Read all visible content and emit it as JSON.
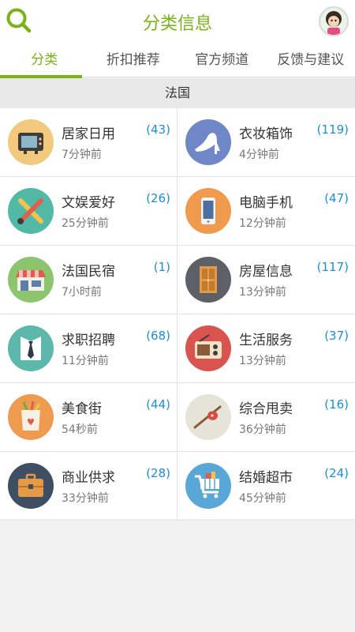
{
  "header": {
    "title": "分类信息",
    "accent_color": "#7ab317",
    "search_icon": "search-icon",
    "avatar_icon": "avatar"
  },
  "tabs": [
    {
      "label": "分类",
      "active": true
    },
    {
      "label": "折扣推荐",
      "active": false
    },
    {
      "label": "官方频道",
      "active": false
    },
    {
      "label": "反馈与建议",
      "active": false
    }
  ],
  "section": {
    "title": "法国"
  },
  "categories": [
    {
      "name": "居家日用",
      "count": "(43)",
      "time": "7分钟前",
      "icon": "tv-icon",
      "color": "#f2c97d"
    },
    {
      "name": "衣妆箱饰",
      "count": "(119)",
      "time": "4分钟前",
      "icon": "high-heel-icon",
      "color": "#6f87c6"
    },
    {
      "name": "文娱爱好",
      "count": "(26)",
      "time": "25分钟前",
      "icon": "art-tools-icon",
      "color": "#52b9a6"
    },
    {
      "name": "电脑手机",
      "count": "(47)",
      "time": "12分钟前",
      "icon": "smartphone-icon",
      "color": "#ef9a4c"
    },
    {
      "name": "法国民宿",
      "count": "(1)",
      "time": "7小时前",
      "icon": "shop-icon",
      "color": "#8cc56d"
    },
    {
      "name": "房屋信息",
      "count": "(117)",
      "time": "13分钟前",
      "icon": "door-icon",
      "color": "#5d6167"
    },
    {
      "name": "求职招聘",
      "count": "(68)",
      "time": "11分钟前",
      "icon": "shirt-tie-icon",
      "color": "#5cb8aa"
    },
    {
      "name": "生活服务",
      "count": "(37)",
      "time": "13分钟前",
      "icon": "radio-icon",
      "color": "#d9534f"
    },
    {
      "name": "美食街",
      "count": "(44)",
      "time": "54秒前",
      "icon": "grocery-bag-icon",
      "color": "#ee9b4f"
    },
    {
      "name": "综合甩卖",
      "count": "(16)",
      "time": "36分钟前",
      "icon": "bindle-icon",
      "color": "#e6e3d9"
    },
    {
      "name": "商业供求",
      "count": "(28)",
      "time": "33分钟前",
      "icon": "briefcase-icon",
      "color": "#3e4f63"
    },
    {
      "name": "结婚超市",
      "count": "(24)",
      "time": "45分钟前",
      "icon": "shopping-cart-icon",
      "color": "#59a7d6"
    }
  ]
}
